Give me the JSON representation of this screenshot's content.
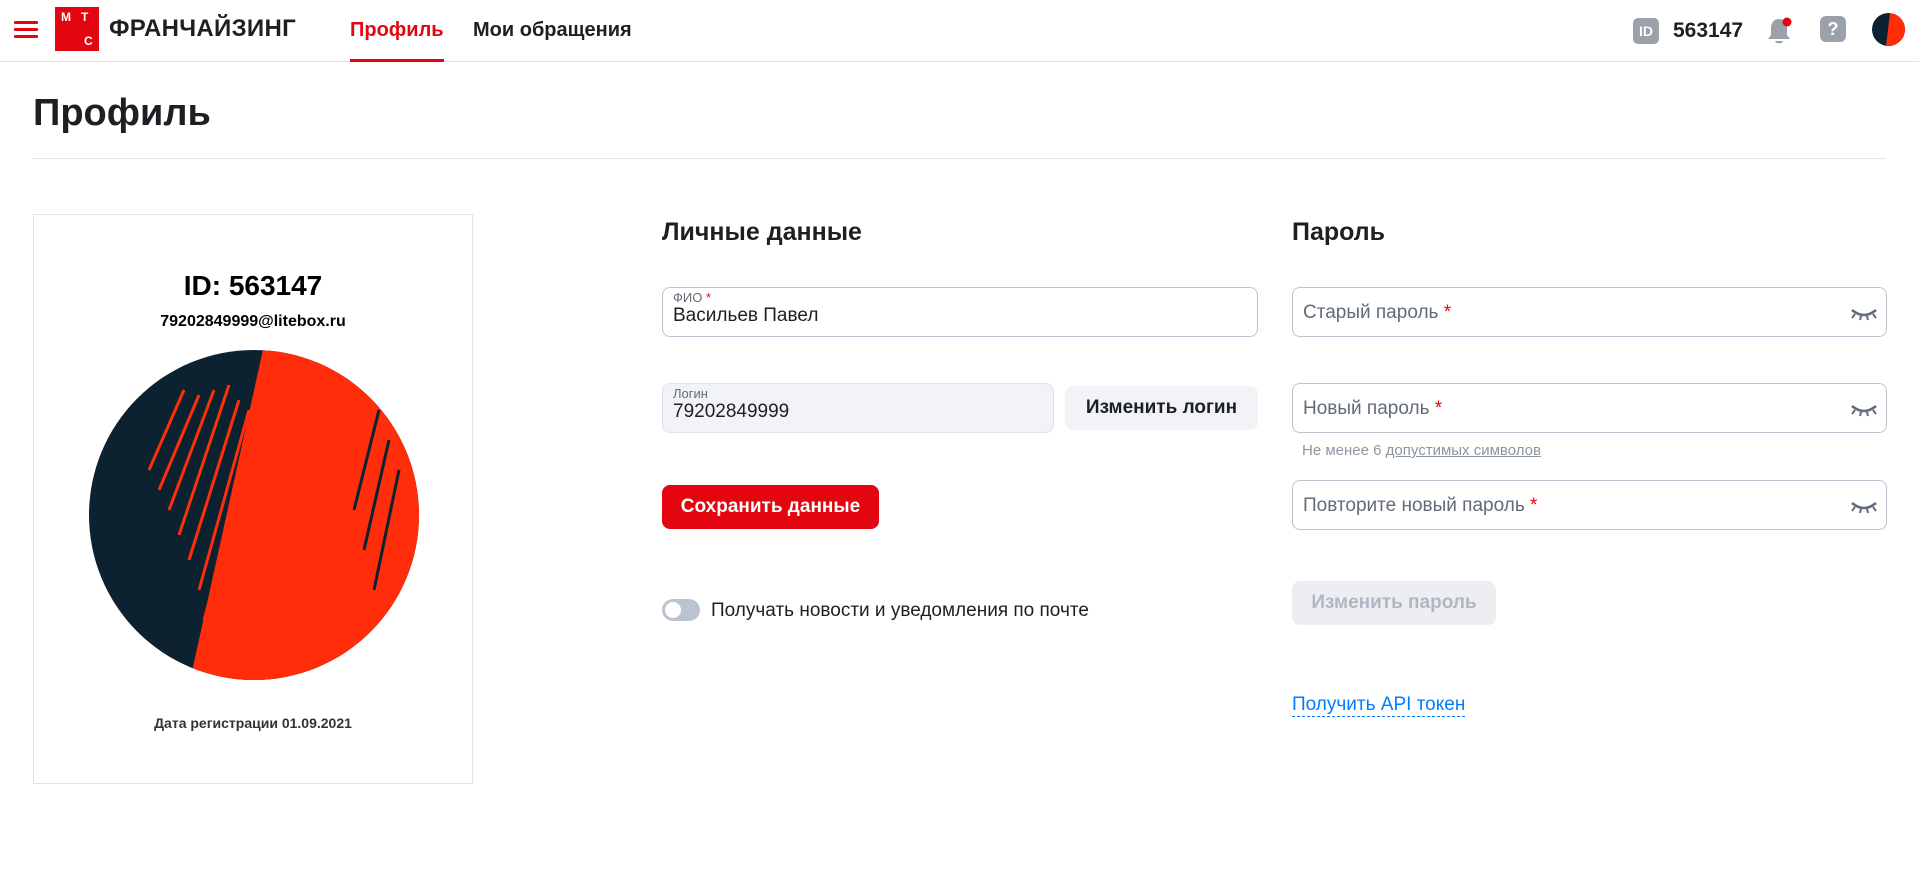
{
  "header": {
    "brand": "ФРАНЧАЙЗИНГ",
    "logo_letters": [
      "М",
      "Т",
      "С"
    ],
    "tabs": [
      {
        "label": "Профиль",
        "active": true
      },
      {
        "label": "Мои обращения",
        "active": false
      }
    ],
    "id_badge": "ID",
    "user_id": "563147",
    "help_symbol": "?",
    "icons": [
      "menu-icon",
      "id-icon",
      "bell-icon",
      "help-icon",
      "avatar"
    ],
    "colors": {
      "brand_red": "#e30611",
      "dark_navy": "#0c2230",
      "link_blue": "#007cff"
    }
  },
  "page": {
    "title": "Профиль"
  },
  "card": {
    "id_label": "ID: 563147",
    "email": "79202849999@litebox.ru",
    "registration": "Дата регистрации 01.09.2021"
  },
  "personal": {
    "heading": "Личные данные",
    "fio_label": "ФИО",
    "fio_required": "*",
    "fio_value": "Васильев Павел",
    "login_label": "Логин",
    "login_value": "79202849999",
    "change_login": "Изменить логин",
    "save": "Сохранить данные",
    "news_toggle_label": "Получать новости и уведомления по почте",
    "news_toggle_on": false
  },
  "password": {
    "heading": "Пароль",
    "old_placeholder": "Старый пароль",
    "new_placeholder": "Новый пароль",
    "repeat_placeholder": "Повторите новый пароль",
    "required": "*",
    "hint_prefix": "Не менее 6",
    "hint_link": "допустимых символов",
    "change_button": "Изменить пароль",
    "api_link": "Получить API токен"
  }
}
